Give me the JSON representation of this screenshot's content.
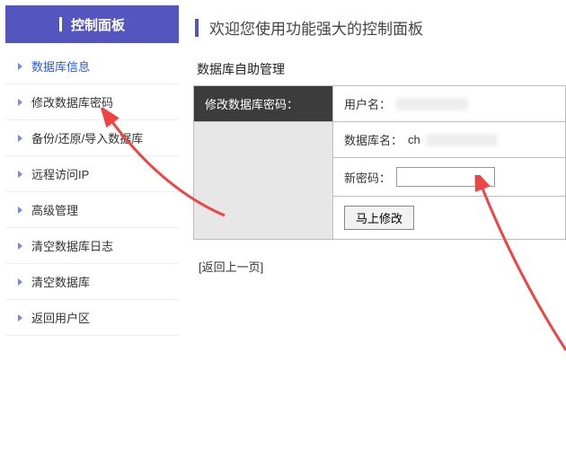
{
  "sidebar": {
    "title": "控制面板",
    "items": [
      {
        "label": "数据库信息"
      },
      {
        "label": "修改数据库密码"
      },
      {
        "label": "备份/还原/导入数据库"
      },
      {
        "label": "远程访问IP"
      },
      {
        "label": "高级管理"
      },
      {
        "label": "清空数据库日志"
      },
      {
        "label": "清空数据库"
      },
      {
        "label": "返回用户区"
      }
    ]
  },
  "main": {
    "title": "欢迎您使用功能强大的控制面板",
    "section_title": "数据库自助管理",
    "form_header": "修改数据库密码：",
    "username_label": "用户名：",
    "username_value": "",
    "dbname_label": "数据库名：",
    "dbname_value": "ch",
    "newpwd_label": "新密码：",
    "newpwd_value": "",
    "submit_label": "马上修改",
    "back_label": "[返回上一页]"
  }
}
